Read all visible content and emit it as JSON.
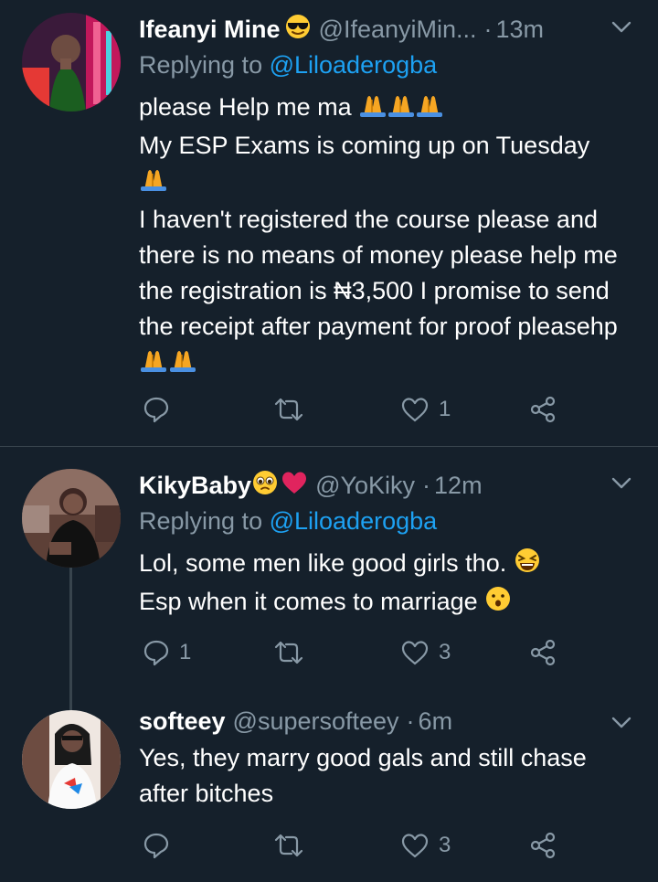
{
  "colors": {
    "background": "#15202b",
    "secondary_text": "#8899a6",
    "link": "#1da1f2",
    "divider": "#38444d"
  },
  "tweets": [
    {
      "name": "Ifeanyi Mine",
      "name_emoji": "sunglasses-emoji",
      "handle": "@IfeanyiMin...",
      "dot": "·",
      "time": "13m",
      "replying_prefix": "Replying to ",
      "replying_to": "@Liloaderogba",
      "lines": [
        "please Help me ma",
        "My ESP Exams is coming up on Tuesday",
        "I haven't registered the course please and there is no means of money please help me the registration is ₦3,500 I promise to send the receipt after payment for proof pleasehp"
      ],
      "reply_count": "",
      "like_count": "1"
    },
    {
      "name": "KikyBaby",
      "name_emoji": "pleading-face-emoji red-heart-emoji",
      "handle": "@YoKiky",
      "dot": "·",
      "time": "12m",
      "replying_prefix": "Replying to ",
      "replying_to": "@Liloaderogba",
      "lines": [
        "Lol, some men like good girls tho.",
        "Esp when it comes to marriage"
      ],
      "reply_count": "1",
      "like_count": "3"
    },
    {
      "name": "softeey",
      "handle": "@supersofteey",
      "dot": "·",
      "time": "6m",
      "lines": [
        "Yes, they marry good gals and still chase after bitches"
      ],
      "reply_count": "",
      "like_count": "3"
    }
  ]
}
